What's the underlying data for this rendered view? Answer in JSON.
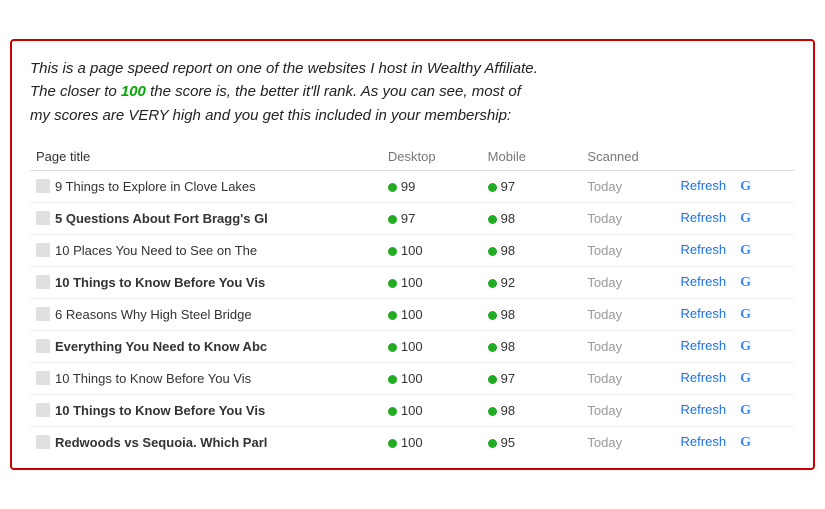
{
  "card": {
    "intro": {
      "line1": "This is a page speed report on one of the websites I host in Wealthy Affiliate.",
      "line2_pre": "The closer to ",
      "line2_highlight": "100",
      "line2_post": " the score is, the better it'll rank. As you can see, most of",
      "line3": "my scores are VERY high and you get this included in your membership:"
    },
    "table": {
      "headers": {
        "title": "Page title",
        "desktop": "Desktop",
        "mobile": "Mobile",
        "scanned": "Scanned"
      },
      "rows": [
        {
          "id": 1,
          "title": "9 Things to Explore in Clove Lakes",
          "desktop_score": "99",
          "desktop_color": "green",
          "mobile_score": "97",
          "mobile_color": "green",
          "scanned": "Today",
          "bold": false
        },
        {
          "id": 2,
          "title": "5 Questions About Fort Bragg's Gl",
          "desktop_score": "97",
          "desktop_color": "green",
          "mobile_score": "98",
          "mobile_color": "green",
          "scanned": "Today",
          "bold": true
        },
        {
          "id": 3,
          "title": "10 Places You Need to See on The",
          "desktop_score": "100",
          "desktop_color": "green",
          "mobile_score": "98",
          "mobile_color": "green",
          "scanned": "Today",
          "bold": false
        },
        {
          "id": 4,
          "title": "10 Things to Know Before You Vis",
          "desktop_score": "100",
          "desktop_color": "green",
          "mobile_score": "92",
          "mobile_color": "green",
          "scanned": "Today",
          "bold": true
        },
        {
          "id": 5,
          "title": "6 Reasons Why High Steel Bridge",
          "desktop_score": "100",
          "desktop_color": "green",
          "mobile_score": "98",
          "mobile_color": "green",
          "scanned": "Today",
          "bold": false
        },
        {
          "id": 6,
          "title": "Everything You Need to Know Abc",
          "desktop_score": "100",
          "desktop_color": "green",
          "mobile_score": "98",
          "mobile_color": "green",
          "scanned": "Today",
          "bold": true
        },
        {
          "id": 7,
          "title": "10 Things to Know Before You Vis",
          "desktop_score": "100",
          "desktop_color": "green",
          "mobile_score": "97",
          "mobile_color": "green",
          "scanned": "Today",
          "bold": false
        },
        {
          "id": 8,
          "title": "10 Things to Know Before You Vis",
          "desktop_score": "100",
          "desktop_color": "green",
          "mobile_score": "98",
          "mobile_color": "green",
          "scanned": "Today",
          "bold": false
        },
        {
          "id": 9,
          "title": "Redwoods vs Sequoia. Which Parl",
          "desktop_score": "100",
          "desktop_color": "green",
          "mobile_score": "95",
          "mobile_color": "green",
          "scanned": "Today",
          "bold": true
        }
      ],
      "refresh_label": "Refresh",
      "g_label": "G"
    }
  }
}
